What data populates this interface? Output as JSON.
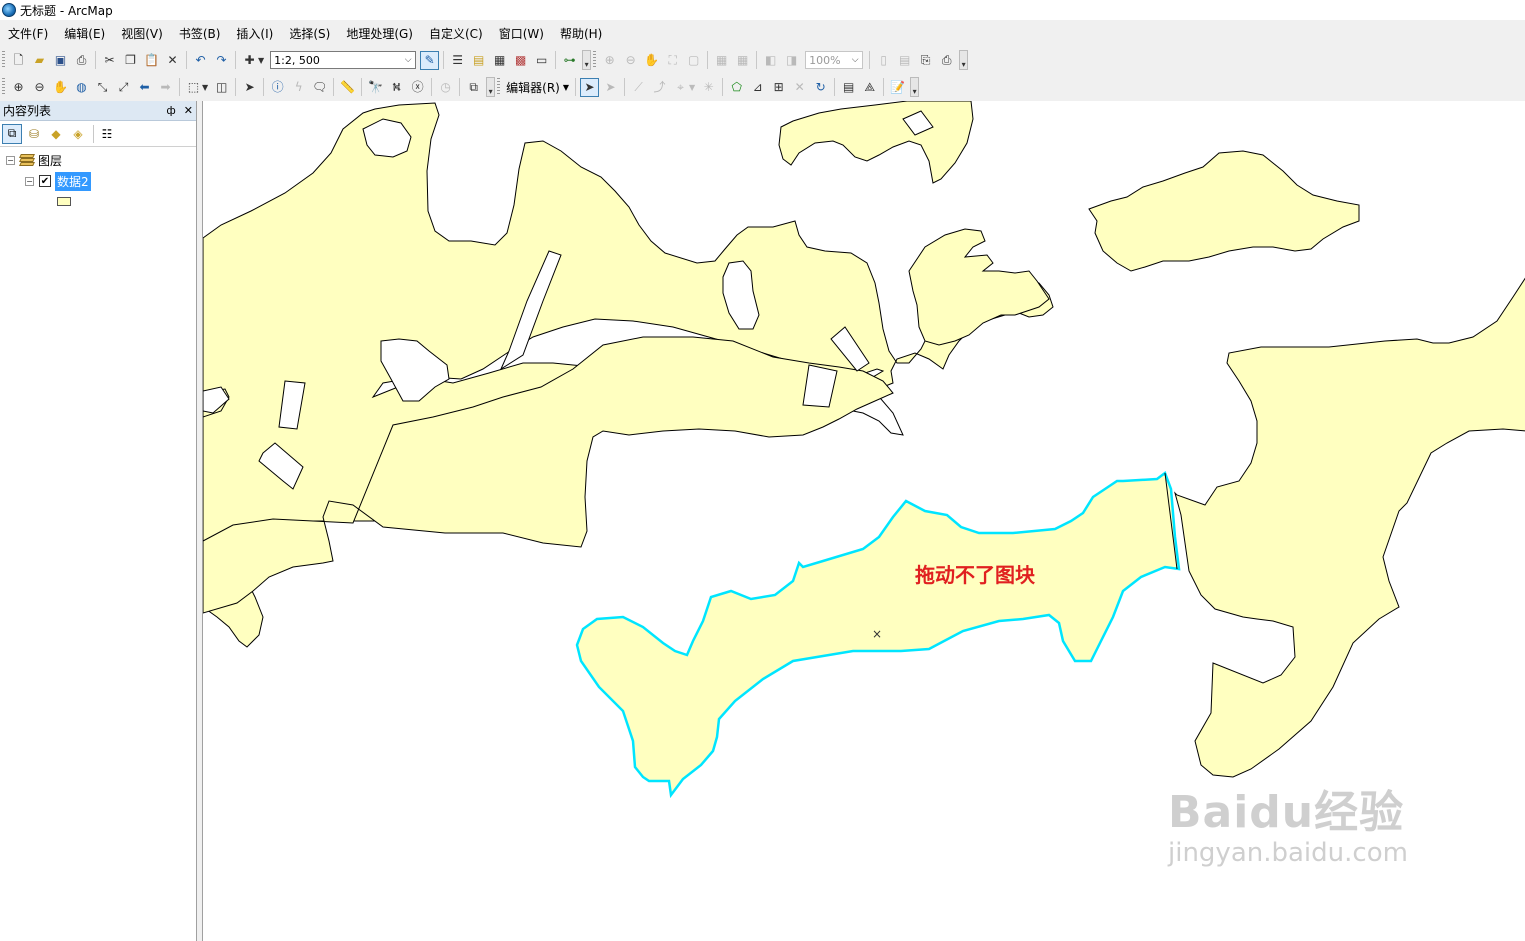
{
  "window": {
    "title": "无标题 - ArcMap"
  },
  "menu": [
    "文件(F)",
    "编辑(E)",
    "视图(V)",
    "书签(B)",
    "插入(I)",
    "选择(S)",
    "地理处理(G)",
    "自定义(C)",
    "窗口(W)",
    "帮助(H)"
  ],
  "toolbar1": {
    "scale_value": "1:2, 500",
    "zoom_value": "100%"
  },
  "toolbar2": {
    "editor_label": "编辑器(R)"
  },
  "toc": {
    "title": "内容列表",
    "pin_glyph": "ф",
    "close_glyph": "✕",
    "root_label": "图层",
    "layer_label": "数据2",
    "layer_checked": true,
    "legend_fill": "#ffffc0"
  },
  "map": {
    "polygon_fill": "#ffffc0",
    "outline_color": "#000000",
    "selection_color": "#00e5ff",
    "annotation": "拖动不了图块",
    "annotation_color": "#e02020",
    "vertex_marker": "×"
  },
  "watermark": {
    "brand": "Baidu经验",
    "url": "jingyan.baidu.com"
  },
  "icons": {
    "app": "arcmap-globe-icon",
    "layers": "layers-icon"
  }
}
